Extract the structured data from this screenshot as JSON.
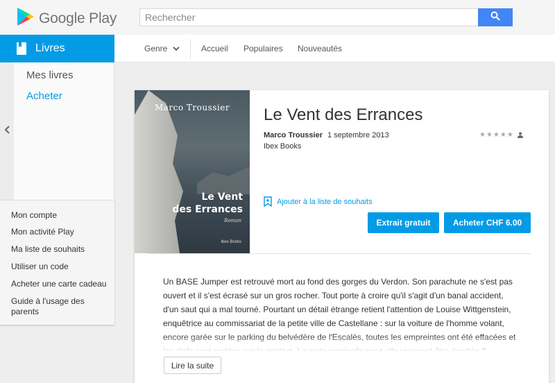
{
  "header": {
    "logo_text": "Google Play",
    "search": {
      "placeholder": "Rechercher"
    }
  },
  "sidebar": {
    "section_label": "Livres",
    "sub_items": [
      {
        "label": "Mes livres"
      },
      {
        "label": "Acheter",
        "active": true
      }
    ],
    "links": [
      {
        "label": "Mon compte"
      },
      {
        "label": "Mon activité Play"
      },
      {
        "label": "Ma liste de souhaits"
      },
      {
        "label": "Utiliser un code"
      },
      {
        "label": "Acheter une carte cadeau"
      },
      {
        "label": "Guide à l'usage des parents"
      }
    ]
  },
  "topnav": {
    "genre_label": "Genre",
    "tabs": [
      {
        "label": "Accueil"
      },
      {
        "label": "Populaires"
      },
      {
        "label": "Nouveautés"
      }
    ]
  },
  "book": {
    "cover": {
      "author": "Marco Troussier",
      "title_line1": "Le Vent",
      "title_line2": "des Errances",
      "genre": "Roman",
      "publisher": "Ibex Books"
    },
    "title": "Le Vent des Errances",
    "author": "Marco Troussier",
    "date": "1 septembre 2013",
    "publisher": "Ibex Books",
    "rating_stars": 0,
    "wishlist_label": "Ajouter à la liste de souhaits",
    "sample_button": "Extrait gratuit",
    "buy_button": "Acheter CHF 6.00",
    "description": "Un BASE Jumper est retrouvé mort au fond des gorges du Verdon. Son parachute ne s'est pas ouvert et il s'est écrasé sur un gros rocher. Tout porte à croire qu'il s'agit d'un banal accident, d'un saut qui a mal tourné. Pourtant un détail étrange retient l'attention de Louise Wittgenstein, enquêtrice au commissariat de la petite ville de Castellane : sur la voiture de l'homme volant, encore garée sur le parking du belvédère de l'Escalès, toutes les empreintes ont été effacées et les clefs sont restées sur le contact. La piste criminelle peut-elle vraiment être écartée ?",
    "read_more": "Lire la suite"
  },
  "colors": {
    "accent": "#039be5",
    "search_button": "#4285f4"
  }
}
